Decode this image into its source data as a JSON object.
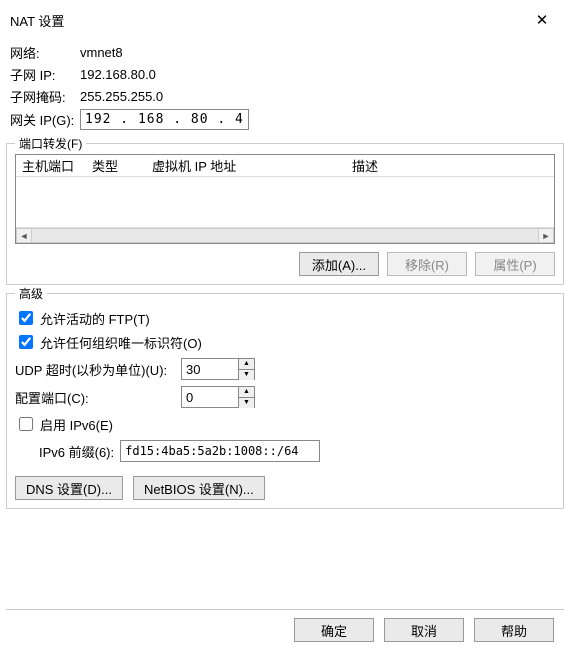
{
  "title": "NAT 设置",
  "network": {
    "label": "网络:",
    "value": "vmnet8"
  },
  "subnet_ip": {
    "label": "子网 IP:",
    "value": "192.168.80.0"
  },
  "subnet_mask": {
    "label": "子网掩码:",
    "value": "255.255.255.0"
  },
  "gateway": {
    "label": "网关 IP(G):",
    "value": "192 . 168 . 80 .  4"
  },
  "port_forward": {
    "title": "端口转发(F)",
    "cols": {
      "host_port": "主机端口",
      "type": "类型",
      "vm_ip": "虚拟机 IP 地址",
      "desc": "描述"
    },
    "rows": []
  },
  "buttons": {
    "add": "添加(A)...",
    "remove": "移除(R)",
    "props": "属性(P)"
  },
  "advanced": {
    "title": "高级",
    "allow_ftp": "允许活动的 FTP(T)",
    "allow_ftp_checked": true,
    "allow_any_org": "允许任何组织唯一标识符(O)",
    "allow_any_org_checked": true,
    "udp_timeout_label": "UDP 超时(以秒为单位)(U):",
    "udp_timeout_value": "30",
    "config_port_label": "配置端口(C):",
    "config_port_value": "0",
    "enable_ipv6": "启用 IPv6(E)",
    "enable_ipv6_checked": false,
    "ipv6_prefix_label": "IPv6 前缀(6):",
    "ipv6_prefix_value": "fd15:4ba5:5a2b:1008::/64",
    "dns_btn": "DNS 设置(D)...",
    "netbios_btn": "NetBIOS 设置(N)..."
  },
  "footer": {
    "ok": "确定",
    "cancel": "取消",
    "help": "帮助"
  }
}
